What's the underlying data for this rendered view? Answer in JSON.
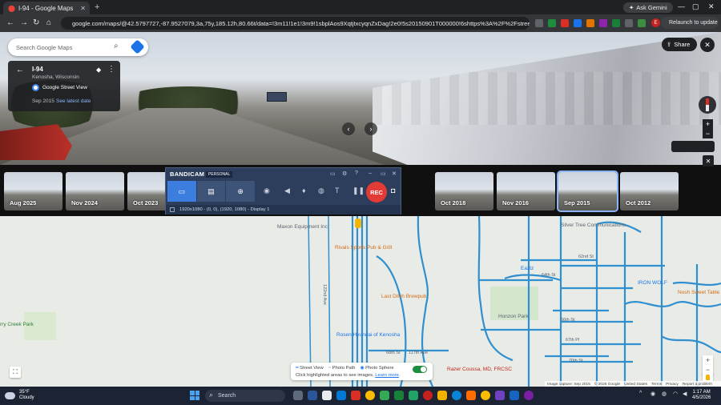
{
  "browser": {
    "tab_title": "I-94 - Google Maps",
    "new_tab": "+",
    "ask_gemini": "Ask Gemini",
    "url": "google.com/maps/@42.5797727,-87.9527079,3a,75y,185.12h,80.66t/data=!3m11!1e1!3m9!1sbplAos9XqtjtxcyqnZxDag!2e0!5s20150901T000000!6shttps%3A%2F%2Fstreetviewpixels-pa.google...",
    "relaunch": "Relaunch to update",
    "avatar_letter": "E"
  },
  "streetview": {
    "search_placeholder": "Search Google Maps",
    "card_title": "I-94",
    "card_subtitle": "Kenosha, Wisconsin",
    "card_source": "Google Street View",
    "card_date": "Sep 2015",
    "card_latest": "See latest date",
    "share_label": "Share",
    "zoom_in": "+",
    "zoom_out": "−"
  },
  "timeline": {
    "thumbnails": [
      {
        "label": "Aug 2025"
      },
      {
        "label": "Nov 2024"
      },
      {
        "label": "Oct 2023"
      },
      {
        "label": "Oct 2018"
      },
      {
        "label": "Nov 2016"
      },
      {
        "label": "Sep 2015",
        "selected": true
      },
      {
        "label": "Oct 2012"
      }
    ]
  },
  "bandicam": {
    "logo": "BANDICAM",
    "edition": "PERSONAL",
    "rec": "REC",
    "status": "1920x1080 - (0, 0), (1920, 1080) - Display 1"
  },
  "map": {
    "places": {
      "maxon": "Maxon Equipment Inc",
      "rivals": "Rivals Sports Pub & Grill",
      "last_ditch": "Last Ditch Brewpub",
      "rosen": "Rosen Hyundai of Kenosha",
      "razer": "Razer Coussa, MD, FRCSC",
      "silver_tree": "Silver Tree Communications",
      "eaztz": "Eaztz",
      "iron_wolf": "IRON WOLF",
      "nosh": "Nosh Sweet Table",
      "honzon": "Honzon Park",
      "creek_park": "rry Creek Park"
    },
    "roads": {
      "r62nd": "62nd St",
      "r64th": "64th St",
      "r66th": "66th St",
      "r67th": "67th Pl",
      "r68th": "68th St",
      "r70th": "70th St",
      "ave": "117th Ave",
      "ave122": "122nd Ave"
    }
  },
  "legend": {
    "street_view": "Street View",
    "photo_path": "Photo Path",
    "photo_sphere": "Photo Sphere",
    "hint": "Click highlighted areas to see images.",
    "learn_more": "Learn more"
  },
  "attribution": {
    "capture": "Image capture: Sep 2015",
    "copyright": "© 2026 Google",
    "region": "United States",
    "terms": "Terms",
    "privacy": "Privacy",
    "report": "Report a problem"
  },
  "taskbar": {
    "temp": "35°F",
    "condition": "Cloudy",
    "search": "Search",
    "time": "1:17 AM",
    "date": "4/5/2026"
  },
  "colors": {
    "road_blue": "#2f8fcf",
    "rec_red": "#e23b36",
    "bandicam_bg": "#2c3e5c"
  }
}
